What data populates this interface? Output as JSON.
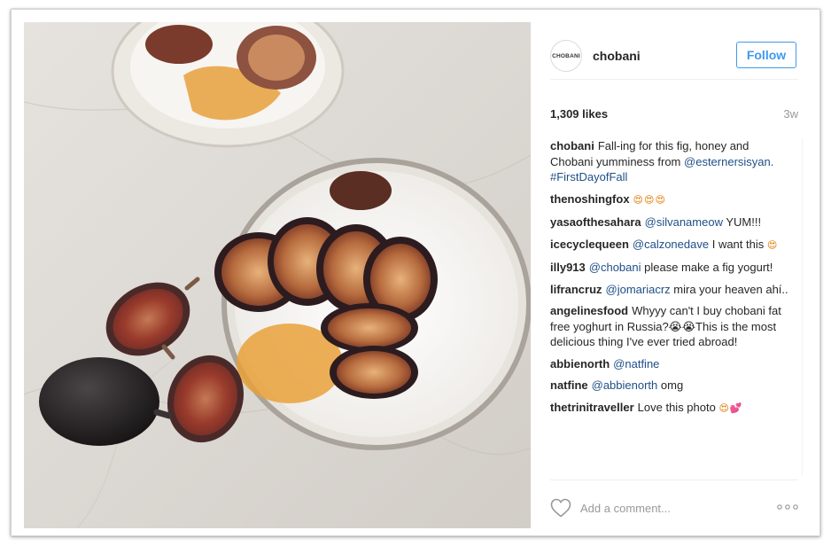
{
  "post": {
    "username": "chobani",
    "avatar_text": "CHOBANI",
    "follow_label": "Follow",
    "likes": "1,309 likes",
    "age": "3w"
  },
  "caption": {
    "user": "chobani",
    "text_1": "Fall-ing for this fig, honey and Chobani yumminess from",
    "mention": "@esternersisyan.",
    "hashtag": "#FirstDayofFall"
  },
  "comments": [
    {
      "user": "thenoshingfox",
      "text": "",
      "tag": "",
      "emoji": "😍😍😍"
    },
    {
      "user": "yasaofthesahara",
      "tag": "@silvanameow",
      "text": "YUM!!!",
      "emoji": ""
    },
    {
      "user": "icecyclequeen",
      "tag": "@calzonedave",
      "text": "I want this",
      "emoji": "😍"
    },
    {
      "user": "illy913",
      "tag": "@chobani",
      "text": "please make a fig yogurt!",
      "emoji": ""
    },
    {
      "user": "lifrancruz",
      "tag": "@jomariacrz",
      "text": "mira your heaven ahí..",
      "emoji": ""
    },
    {
      "user": "angelinesfood",
      "tag": "",
      "text": "Whyyy can't I buy chobani fat free yoghurt in Russia?😭😭This is the most delicious thing I've ever tried abroad!",
      "emoji": ""
    },
    {
      "user": "abbienorth",
      "tag": "@natfine",
      "text": "",
      "emoji": ""
    },
    {
      "user": "natfine",
      "tag": "@abbienorth",
      "text": "omg",
      "emoji": ""
    },
    {
      "user": "thetrinitraveller",
      "tag": "",
      "text": "Love this photo",
      "emoji": "😍💕"
    }
  ],
  "footer": {
    "placeholder": "Add a comment..."
  },
  "icons": {
    "like": "heart-icon",
    "more": "more-options-icon"
  }
}
